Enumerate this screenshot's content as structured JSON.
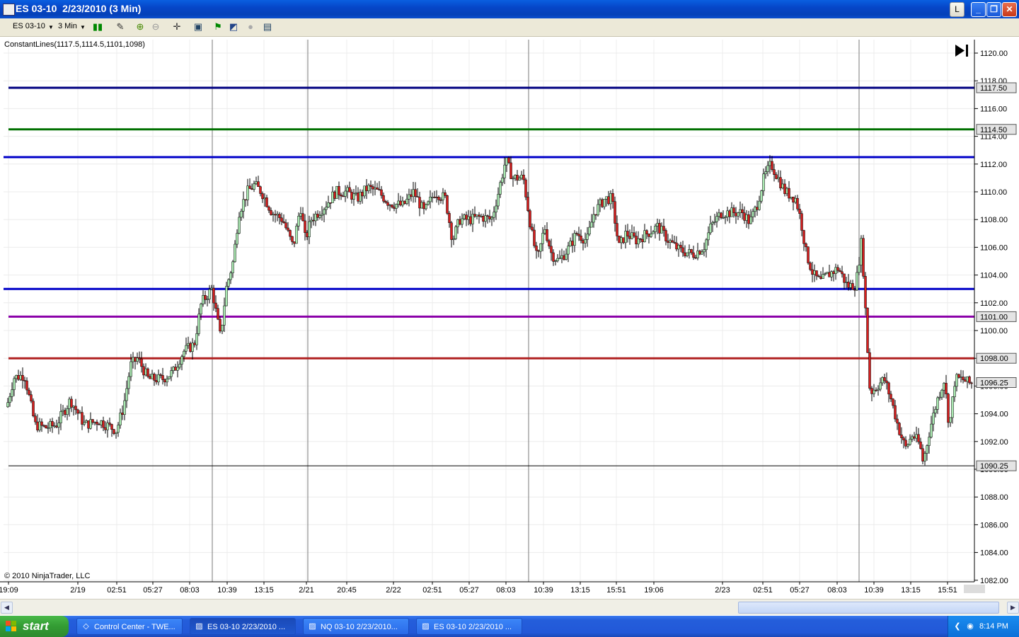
{
  "window": {
    "title": "ES 03-10  2/23/2010 (3 Min)",
    "btn_l": "L"
  },
  "toolbar": {
    "instrument": "ES 03-10",
    "interval": "3 Min"
  },
  "chart": {
    "indicator_label": "ConstantLines(1117.5,1114.5,1101,1098)",
    "copyright": "© 2010 NinjaTrader, LLC",
    "colors": {
      "up": "#a8e8b0",
      "down": "#d61e1e"
    },
    "price_axis": [
      "1120.00",
      "1118.00",
      "1116.00",
      "1114.00",
      "1112.00",
      "1110.00",
      "1108.00",
      "1106.00",
      "1104.00",
      "1102.00",
      "1100.00",
      "1098.00",
      "1096.00",
      "1094.00",
      "1092.00",
      "1090.00",
      "1088.00",
      "1086.00",
      "1084.00",
      "1082.00"
    ],
    "time_axis": [
      "19:09",
      "2/19",
      "02:51",
      "05:27",
      "08:03",
      "10:39",
      "13:15",
      "2/21",
      "20:45",
      "2/22",
      "02:51",
      "05:27",
      "08:03",
      "10:39",
      "13:15",
      "15:51",
      "19:06",
      "2/23",
      "02:51",
      "05:27",
      "08:03",
      "10:39",
      "13:15",
      "15:51"
    ],
    "lines": [
      {
        "price": 1117.5,
        "label": "1117.50",
        "color": "#000080"
      },
      {
        "price": 1114.5,
        "label": "1114.50",
        "color": "#007000"
      },
      {
        "price": 1112.5,
        "label": "",
        "color": "#0000c8"
      },
      {
        "price": 1103.0,
        "label": "",
        "color": "#0000c8"
      },
      {
        "price": 1101.0,
        "label": "1101.00",
        "color": "#8a00a8"
      },
      {
        "price": 1098.0,
        "label": "1098.00",
        "color": "#b02020"
      },
      {
        "price": 1090.25,
        "label": "1090.25",
        "color": "#000000"
      }
    ],
    "last_price": {
      "price": 1096.25,
      "label": "1096.25"
    }
  },
  "taskbar": {
    "start_label": "start",
    "items": [
      "Control Center - TWE...",
      "ES 03-10  2/23/2010 ...",
      "NQ 03-10  2/23/2010...",
      "ES 03-10  2/23/2010 ..."
    ],
    "clock": "8:14 PM"
  }
}
